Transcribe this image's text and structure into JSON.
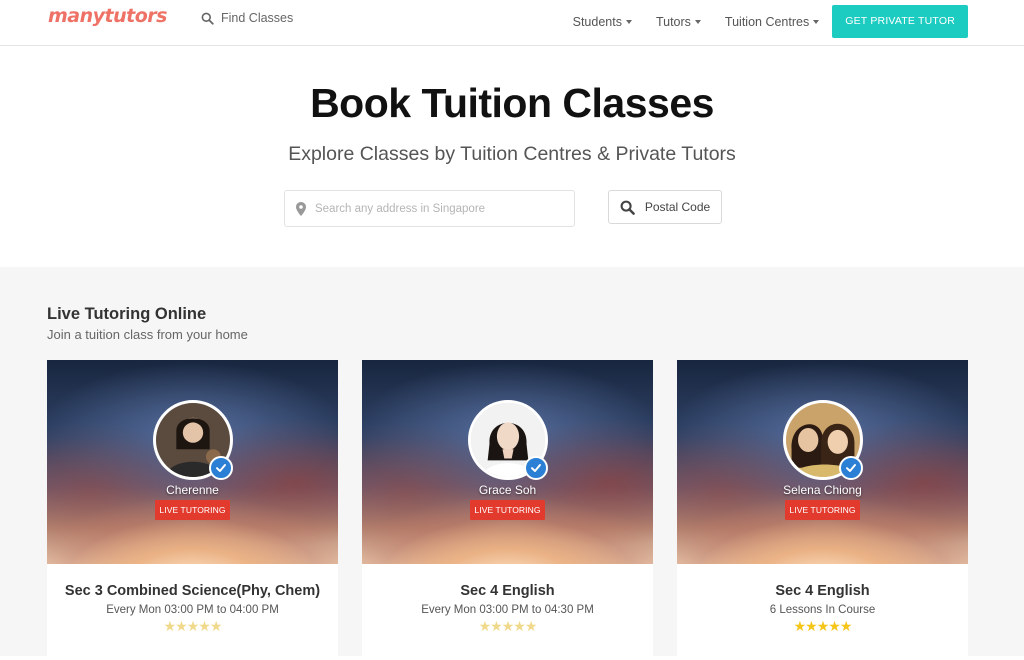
{
  "header": {
    "logo": "manytutors",
    "find_label": "Find Classes",
    "nav": [
      {
        "label": "Students"
      },
      {
        "label": "Tutors"
      },
      {
        "label": "Tuition Centres"
      }
    ],
    "cta_label": "GET PRIVATE TUTOR"
  },
  "hero": {
    "title": "Book Tuition Classes",
    "subtitle": "Explore Classes by Tuition Centres & Private Tutors",
    "search_placeholder": "Search any address in Singapore",
    "postal_label": "Postal Code"
  },
  "section": {
    "title": "Live Tutoring Online",
    "subtitle": "Join a tuition class from your home"
  },
  "cards": [
    {
      "tutor": "Cherenne",
      "badge": "LIVE TUTORING",
      "title": "Sec 3 Combined Science(Phy, Chem)",
      "meta": "Every Mon 03:00 PM to 04:00 PM",
      "rating": 0
    },
    {
      "tutor": "Grace Soh",
      "badge": "LIVE TUTORING",
      "title": "Sec 4 English",
      "meta": "Every Mon 03:00 PM to 04:30 PM",
      "rating": 0
    },
    {
      "tutor": "Selena Chiong",
      "badge": "LIVE TUTORING",
      "title": "Sec 4 English",
      "meta": "6 Lessons In Course",
      "rating": 5
    }
  ],
  "colors": {
    "brand": "#ee7266",
    "cta": "#1dccc1",
    "badge": "#e23b2e",
    "verified": "#2b7fd4",
    "star": "#f5c518"
  }
}
